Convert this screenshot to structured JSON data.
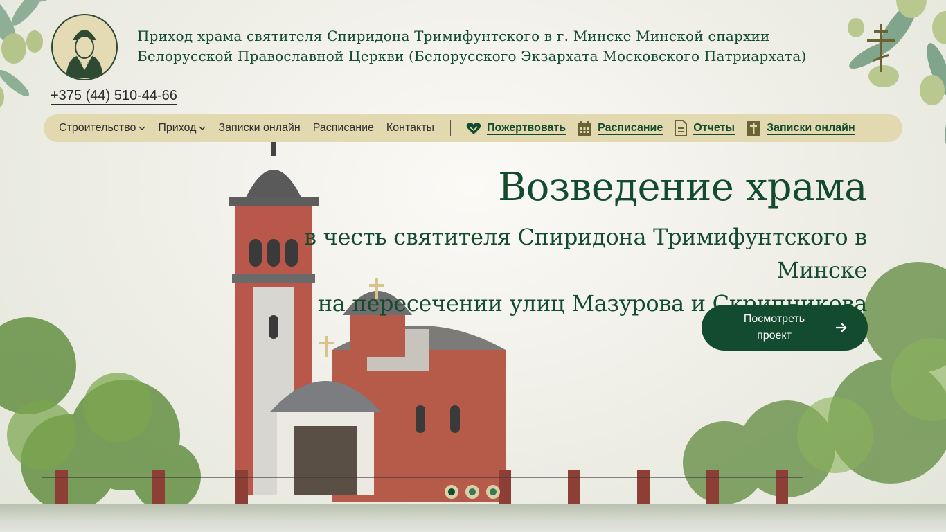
{
  "header": {
    "title": "Приход храма святителя Спиридона Тримифунтского в г. Минске Минской епархии Белорусской Православной Церкви (Белорусского Экзархата Московского Патриархата)",
    "phone": "+375 (44) 510-44-66"
  },
  "nav": {
    "items": [
      {
        "label": "Строительство",
        "has_dropdown": true
      },
      {
        "label": "Приход",
        "has_dropdown": true
      },
      {
        "label": "Записки онлайн",
        "has_dropdown": false
      },
      {
        "label": "Расписание",
        "has_dropdown": false
      },
      {
        "label": "Контакты",
        "has_dropdown": false
      }
    ],
    "quick_links": [
      {
        "label": "Пожертвовать",
        "icon": "heart-hands-icon"
      },
      {
        "label": "Расписание",
        "icon": "calendar-icon"
      },
      {
        "label": "Отчеты",
        "icon": "document-icon"
      },
      {
        "label": "Записки онлайн",
        "icon": "note-cross-icon"
      }
    ]
  },
  "hero": {
    "title": "Возведение храма",
    "subtitle_line1": "в честь святителя Спиридона Тримифунтского в Минске",
    "subtitle_line2": "на пересечении улиц Мазурова и Скрипникова",
    "cta_label": "Посмотреть проект",
    "slides_total": 3,
    "active_slide": 1
  },
  "colors": {
    "brand_green": "#134b2e",
    "nav_bg": "#e2d9b0",
    "text_dark": "#2f2f2f"
  }
}
